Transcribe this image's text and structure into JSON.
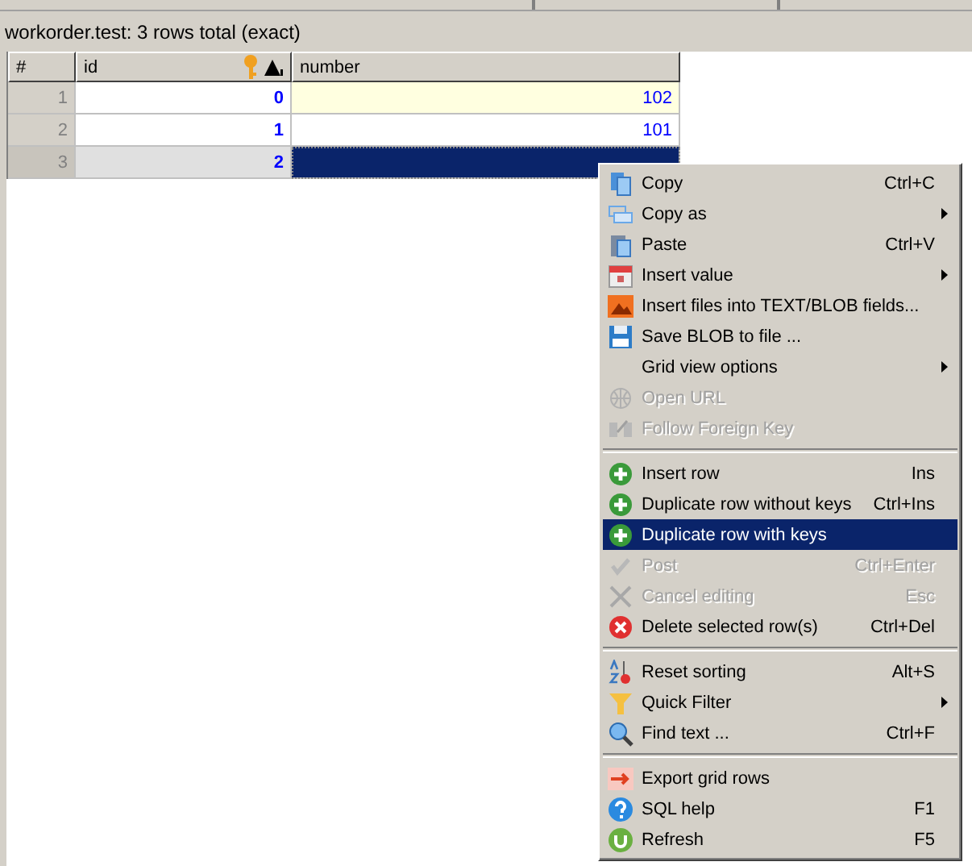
{
  "caption": "workorder.test: 3 rows total (exact)",
  "grid": {
    "columns": [
      {
        "label": "#"
      },
      {
        "label": "id",
        "primary_key": true,
        "sorted": true
      },
      {
        "label": "number"
      }
    ],
    "rows": [
      {
        "number_label": "1",
        "id": "0",
        "number": "102",
        "selected": false,
        "highlight": true
      },
      {
        "number_label": "2",
        "id": "1",
        "number": "101",
        "selected": false,
        "highlight": false
      },
      {
        "number_label": "3",
        "id": "2",
        "selected": true,
        "highlight": false
      }
    ]
  },
  "context_menu": {
    "items": [
      {
        "kind": "item",
        "label": "Copy",
        "shortcut": "Ctrl+C",
        "submenu": false,
        "disabled": false,
        "selected": false
      },
      {
        "kind": "item",
        "label": "Copy as",
        "submenu": true,
        "disabled": false,
        "selected": false
      },
      {
        "kind": "item",
        "label": "Paste",
        "shortcut": "Ctrl+V",
        "submenu": false,
        "disabled": false,
        "selected": false
      },
      {
        "kind": "item",
        "label": "Insert value",
        "submenu": true,
        "disabled": false,
        "selected": false
      },
      {
        "kind": "item",
        "label": "Insert files into TEXT/BLOB fields...",
        "submenu": false,
        "disabled": false,
        "selected": false
      },
      {
        "kind": "item",
        "label": "Save BLOB to file ...",
        "submenu": false,
        "disabled": false,
        "selected": false
      },
      {
        "kind": "item",
        "label": "Grid view options",
        "submenu": true,
        "disabled": false,
        "selected": false
      },
      {
        "kind": "item",
        "label": "Open URL",
        "submenu": false,
        "disabled": true,
        "selected": false
      },
      {
        "kind": "item",
        "label": "Follow Foreign Key",
        "submenu": false,
        "disabled": true,
        "selected": false
      },
      {
        "kind": "separator"
      },
      {
        "kind": "item",
        "label": "Insert row",
        "shortcut": "Ins",
        "submenu": false,
        "disabled": false,
        "selected": false
      },
      {
        "kind": "item",
        "label": "Duplicate row without keys",
        "shortcut": "Ctrl+Ins",
        "submenu": false,
        "disabled": false,
        "selected": false
      },
      {
        "kind": "item",
        "label": "Duplicate row with keys",
        "submenu": false,
        "disabled": false,
        "selected": true
      },
      {
        "kind": "item",
        "label": "Post",
        "shortcut": "Ctrl+Enter",
        "submenu": false,
        "disabled": true,
        "selected": false
      },
      {
        "kind": "item",
        "label": "Cancel editing",
        "shortcut": "Esc",
        "submenu": false,
        "disabled": true,
        "selected": false
      },
      {
        "kind": "item",
        "label": "Delete selected row(s)",
        "shortcut": "Ctrl+Del",
        "submenu": false,
        "disabled": false,
        "selected": false
      },
      {
        "kind": "separator"
      },
      {
        "kind": "item",
        "label": "Reset sorting",
        "shortcut": "Alt+S",
        "submenu": false,
        "disabled": false,
        "selected": false
      },
      {
        "kind": "item",
        "label": "Quick Filter",
        "submenu": true,
        "disabled": false,
        "selected": false
      },
      {
        "kind": "item",
        "label": "Find text ...",
        "shortcut": "Ctrl+F",
        "submenu": false,
        "disabled": false,
        "selected": false
      },
      {
        "kind": "separator"
      },
      {
        "kind": "item",
        "label": "Export grid rows",
        "submenu": false,
        "disabled": false,
        "selected": false
      },
      {
        "kind": "item",
        "label": "SQL help",
        "shortcut": "F1",
        "submenu": false,
        "disabled": false,
        "selected": false
      },
      {
        "kind": "item",
        "label": "Refresh",
        "shortcut": "F5",
        "submenu": false,
        "disabled": false,
        "selected": false
      }
    ]
  }
}
